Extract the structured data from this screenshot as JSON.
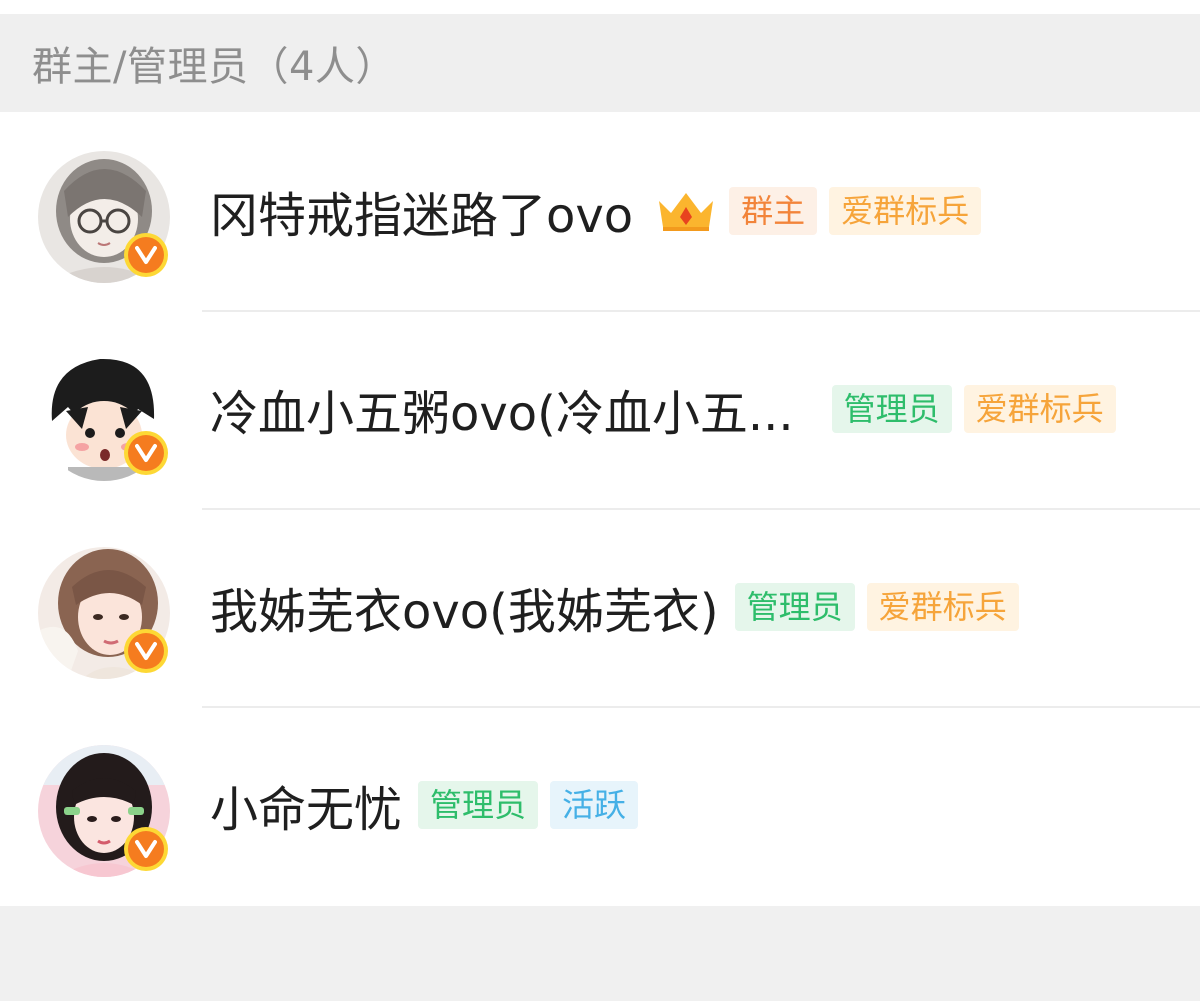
{
  "header": {
    "title": "群主/管理员（4人）"
  },
  "members": [
    {
      "name": "冈特戒指迷路了ovo",
      "tags": [
        {
          "label": "群主",
          "kind": "owner"
        },
        {
          "label": "爱群标兵",
          "kind": "fan"
        }
      ],
      "has_crown": true,
      "badge_icon": "v-verified-icon"
    },
    {
      "name": "冷血小五粥ovo(冷血小五...",
      "tags": [
        {
          "label": "管理员",
          "kind": "admin"
        },
        {
          "label": "爱群标兵",
          "kind": "fan"
        }
      ],
      "has_crown": false,
      "badge_icon": "v-verified-icon"
    },
    {
      "name": "我姊芜衣ovo(我姊芜衣)",
      "tags": [
        {
          "label": "管理员",
          "kind": "admin"
        },
        {
          "label": "爱群标兵",
          "kind": "fan"
        }
      ],
      "has_crown": false,
      "badge_icon": "v-verified-icon"
    },
    {
      "name": "小命无忧",
      "tags": [
        {
          "label": "管理员",
          "kind": "admin"
        },
        {
          "label": "活跃",
          "kind": "active"
        }
      ],
      "has_crown": false,
      "badge_icon": "v-verified-icon"
    }
  ],
  "colors": {
    "owner_tag_text": "#f2843a",
    "admin_tag_text": "#2ebd6b",
    "fan_tag_text": "#f6a43a",
    "active_tag_text": "#45b0e6",
    "verified_badge": "#f57c1f"
  }
}
